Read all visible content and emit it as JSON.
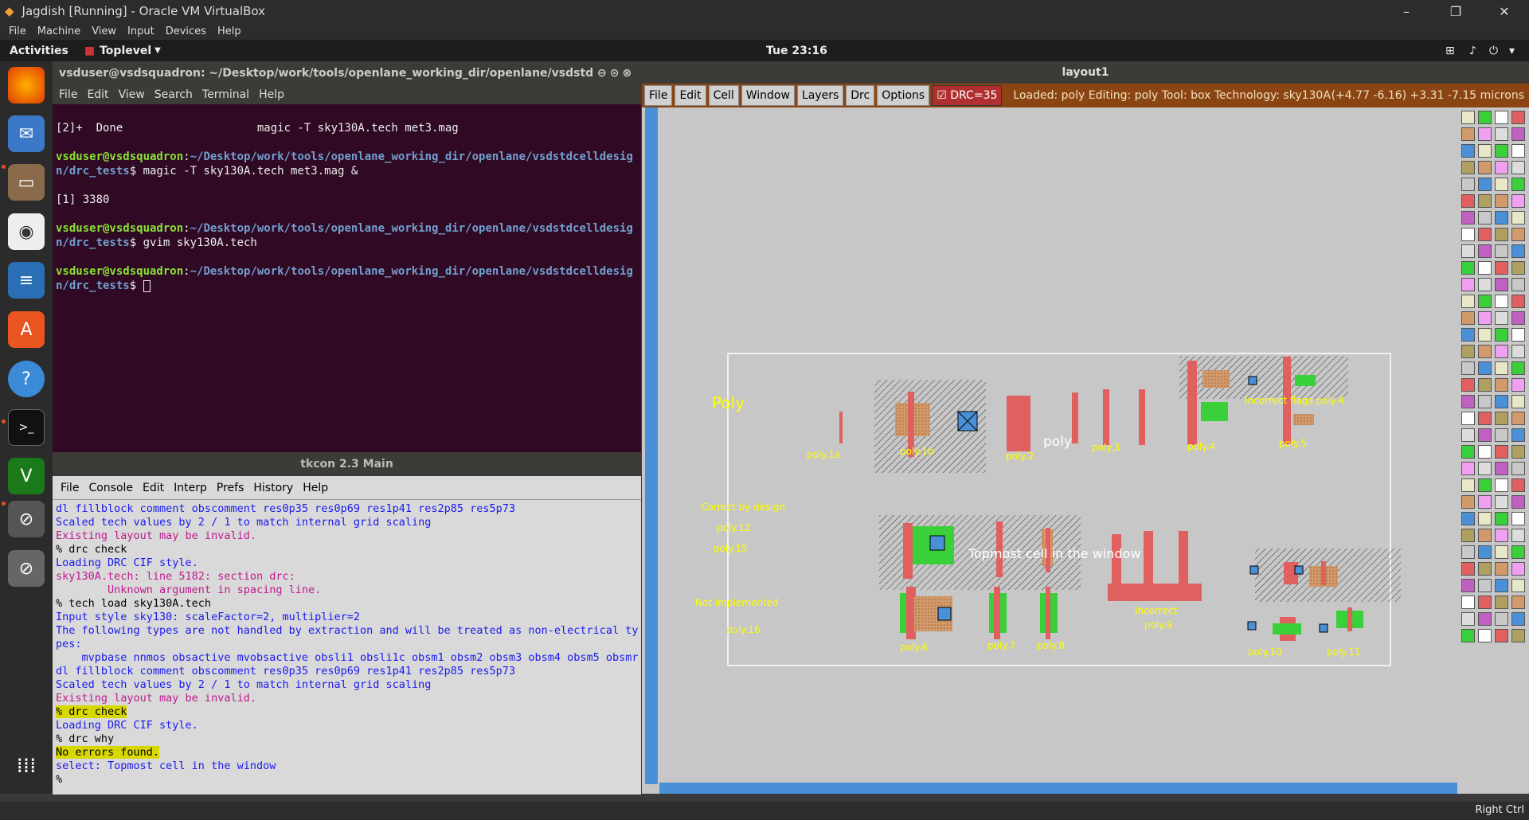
{
  "vbox": {
    "title": "Jagdish [Running] - Oracle VM VirtualBox",
    "menu": [
      "File",
      "Machine",
      "View",
      "Input",
      "Devices",
      "Help"
    ]
  },
  "topbar": {
    "activities": "Activities",
    "app": "Toplevel",
    "clock": "Tue 23:16"
  },
  "terminal": {
    "title": "vsduser@vsdsquadron: ~/Desktop/work/tools/openlane_working_dir/openlane/vsdstdcelld...",
    "menu": [
      "File",
      "Edit",
      "View",
      "Search",
      "Terminal",
      "Help"
    ],
    "lines": [
      {
        "t": "[2]+  Done                    magic -T sky130A.tech met3.mag"
      },
      {
        "p": "vsduser@vsdsquadron",
        "d": "~/Desktop/work/tools/openlane_working_dir/openlane/vsdstdcelldesign/drc_tests",
        "c": "$ magic -T sky130A.tech met3.mag &"
      },
      {
        "t": "[1] 3380"
      },
      {
        "p": "vsduser@vsdsquadron",
        "d": "~/Desktop/work/tools/openlane_working_dir/openlane/vsdstdcelldesign/drc_tests",
        "c": "$ gvim sky130A.tech"
      },
      {
        "p": "vsduser@vsdsquadron",
        "d": "~/Desktop/work/tools/openlane_working_dir/openlane/vsdstdcelldesign/drc_tests",
        "c": "$ "
      }
    ]
  },
  "tkcon": {
    "title": "tkcon 2.3 Main",
    "menu": [
      "File",
      "Console",
      "Edit",
      "Interp",
      "Prefs",
      "History",
      "Help"
    ],
    "lines": [
      {
        "s": "b",
        "t": "dl fillblock comment obscomment res0p35 res0p69 res1p41 res2p85 res5p73"
      },
      {
        "s": "b",
        "t": "Scaled tech values by 2 / 1 to match internal grid scaling"
      },
      {
        "s": "m",
        "t": "Existing layout may be invalid."
      },
      {
        "s": "k",
        "t": "% drc check"
      },
      {
        "s": "b",
        "t": "Loading DRC CIF style."
      },
      {
        "s": "m",
        "t": "sky130A.tech: line 5182: section drc:"
      },
      {
        "s": "m",
        "t": "        Unknown argument in spacing line."
      },
      {
        "s": "k",
        "t": "% tech load sky130A.tech"
      },
      {
        "s": "b",
        "t": "Input style sky130: scaleFactor=2, multiplier=2"
      },
      {
        "s": "b",
        "t": "The following types are not handled by extraction and will be treated as non-electrical ty"
      },
      {
        "s": "b",
        "t": "pes:"
      },
      {
        "s": "b",
        "t": "    mvpbase nnmos obsactive mvobsactive obsli1 obsli1c obsm1 obsm2 obsm3 obsm4 obsm5 obsmr"
      },
      {
        "s": "b",
        "t": "dl fillblock comment obscomment res0p35 res0p69 res1p41 res2p85 res5p73"
      },
      {
        "s": "b",
        "t": "Scaled tech values by 2 / 1 to match internal grid scaling"
      },
      {
        "s": "m",
        "t": "Existing layout may be invalid."
      },
      {
        "s": "kh",
        "t": "% drc check"
      },
      {
        "s": "b",
        "t": "Loading DRC CIF style."
      },
      {
        "s": "k",
        "t": "% drc why"
      },
      {
        "s": "h",
        "t": "No errors found."
      },
      {
        "s": "b",
        "t": "select: Topmost cell in the window"
      },
      {
        "s": "k",
        "t": "%"
      }
    ]
  },
  "magic": {
    "title": "layout1",
    "menu": [
      "File",
      "Edit",
      "Cell",
      "Window",
      "Layers",
      "Drc",
      "Options"
    ],
    "drc": "DRC=35",
    "status": "Loaded: poly Editing: poly Tool: box  Technology: sky130A",
    "coords": "(+4.77 -6.16) +3.31 -7.15 microns",
    "labels": {
      "poly": "Poly",
      "p1a": "poly.1a",
      "p1b": "poly.1b",
      "p2": "poly.2",
      "polyw": "poly",
      "p3": "poly.3",
      "p4": "poly.4",
      "p5": "poly.5",
      "flags": "Incorrect flags poly.4",
      "correct": "Correct by design",
      "p12": "poly.12",
      "p15": "poly.15",
      "top": "Topmost cell in the window",
      "incorrect": "Incorrect",
      "p9": "poly.9",
      "notimpl": "Not implemented",
      "p16": "poly.16",
      "p6": "poly.6",
      "p7": "poly.7",
      "p8": "poly.8",
      "p10": "poly.10",
      "p11": "poly.11"
    }
  },
  "bottom": {
    "host": "Right Ctrl"
  }
}
